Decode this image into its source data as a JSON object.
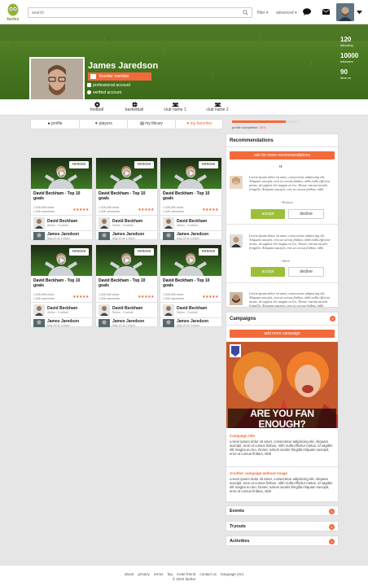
{
  "header": {
    "logo_text": "fanfee",
    "search_placeholder": "search",
    "filter_label": "filter",
    "advanced_label": "advanced"
  },
  "profile": {
    "name": "James Jaredson",
    "badge": "founder member",
    "rows": [
      "professional account",
      "verified account"
    ],
    "stats": [
      {
        "value": "120",
        "label": "following"
      },
      {
        "value": "10000",
        "label": "followers"
      },
      {
        "value": "90",
        "label": "fans on"
      }
    ]
  },
  "sports": [
    "football",
    "basketball",
    "club name 1",
    "club name 2"
  ],
  "tabs": [
    "profile",
    "players",
    "my library",
    "my favorites"
  ],
  "cards": [
    {
      "remove": "remove",
      "title": "David Beckham - Top 10 goals",
      "views": "1,026,006 views",
      "comments": "1,026 comments",
      "stars": "★★★★★",
      "p1_name": "David Beckham",
      "p1_sub": "Striker - Football",
      "p2_name": "James Jaredson",
      "p2_sub": "May 20 at 1:40pm"
    },
    {
      "remove": "remove",
      "title": "David Beckham - Top 10 goals",
      "views": "1,026,006 views",
      "comments": "1,026 comments",
      "stars": "★★★★★",
      "p1_name": "David Beckham",
      "p1_sub": "Striker - Football",
      "p2_name": "James Jaredson",
      "p2_sub": "May 20 at 1:40pm"
    },
    {
      "remove": "remove",
      "title": "David Beckham - Top 10 goals",
      "views": "1,026,006 views",
      "comments": "1,026 comments",
      "stars": "★★★★★",
      "p1_name": "David Beckham",
      "p1_sub": "Striker - Football",
      "p2_name": "James Jaredson",
      "p2_sub": "May 20 at 1:40pm"
    },
    {
      "remove": "remove",
      "title": "David Beckham - Top 10 goals",
      "views": "1,026,006 views",
      "comments": "1,026 comments",
      "stars": "★★★★★",
      "p1_name": "David Beckham",
      "p1_sub": "Striker - Football",
      "p2_name": "James Jaredson",
      "p2_sub": "May 20 at 1:40pm"
    },
    {
      "remove": "remove",
      "title": "David Beckham - Top 10 goals",
      "views": "1,026,006 views",
      "comments": "1,026 comments",
      "stars": "★★★★★",
      "p1_name": "David Beckham",
      "p1_sub": "Striker - Football",
      "p2_name": "James Jaredson",
      "p2_sub": "May 20 at 1:40pm"
    },
    {
      "remove": "remove",
      "title": "David Beckham - Top 10 goals",
      "views": "1,026,006 views",
      "comments": "1,026 comments",
      "stars": "★★★★★",
      "p1_name": "David Beckham",
      "p1_sub": "Striker - Football",
      "p2_name": "James Jaredson",
      "p2_sub": "May 20 at 1:40pm"
    }
  ],
  "progress": {
    "label": "profile completion:",
    "value": "80%",
    "fraction": 0.8
  },
  "recommendations": {
    "title": "Recommendations",
    "ask_button": "ask for more recommendations",
    "quote_mark": "“",
    "items": [
      {
        "text": "Lorem ipsum dolor sit amet, consectetur adipiscing elit. Aliquam suscipit, eros ut cursus finibus, nibh nulla efficitur metus, id sagittis elit magna eu leo. Donec rutrum iaculis fringilla. Aliquam suscipit, eros ut cursus finibus, nibh",
        "name": "- Kristen",
        "accept": "accept",
        "decline": "decline"
      },
      {
        "text": "Lorem ipsum dolor sit amet, consectetur adipiscing elit. Aliquam suscipit, eros ut cursus finibus, nibh nulla efficitur metus, id sagittis elit magna eu leo. Donec rutrum iaculis fringilla. Aliquam suscipit, eros ut cursus finibus, nibh",
        "name": "- Steve",
        "accept": "accept",
        "decline": "decline"
      },
      {
        "text": "Lorem ipsum dolor sit amet, consectetur adipiscing elit. Aliquam suscipit, eros ut cursus finibus, nibh nulla efficitur metus, id sagittis elit magna eu leo. Donec rutrum iaculis fringilla. Aliquam suscipit, eros ut cursus finibus, nibh"
      }
    ]
  },
  "campaigns": {
    "title": "Campaigns",
    "count": "5",
    "add_button": "add more campaign",
    "image_text": "ARE YOU FAN ENOUGH?",
    "items": [
      {
        "title": "Campaign title",
        "body": "Lorem ipsum dolor sit amet, consectetur adipiscing elit. Aliquam suscipit, eros ut cursus finibus, nibh nulla efficitur metus, id sagittis elit magna eu leo. Donec rutrum iaculis fringilla Aliquam suscipit, eros ut cursus finibus, nibh"
      },
      {
        "title": "Another campaign without image",
        "body": "Lorem ipsum dolor sit amet, consectetur adipiscing elit. Aliquam suscipit, eros ut cursus finibus, nibh nulla efficitur metus, id sagittis elit magna eu leo. Donec rutrum iaculis fringilla Aliquam suscipit, eros ut cursus finibus, nibh"
      }
    ]
  },
  "sections": [
    {
      "title": "Events",
      "count": "5"
    },
    {
      "title": "Tryouts",
      "count": "5"
    },
    {
      "title": "Activities",
      "count": "5"
    }
  ],
  "footer": {
    "links": [
      "about",
      "privacy",
      "terms",
      "faq",
      "invite friend",
      "contact us",
      "language (en)"
    ],
    "copyright": "© 2016 fanfee"
  },
  "colors": {
    "accent": "#f26a3b",
    "accept": "#9cbf3a"
  }
}
